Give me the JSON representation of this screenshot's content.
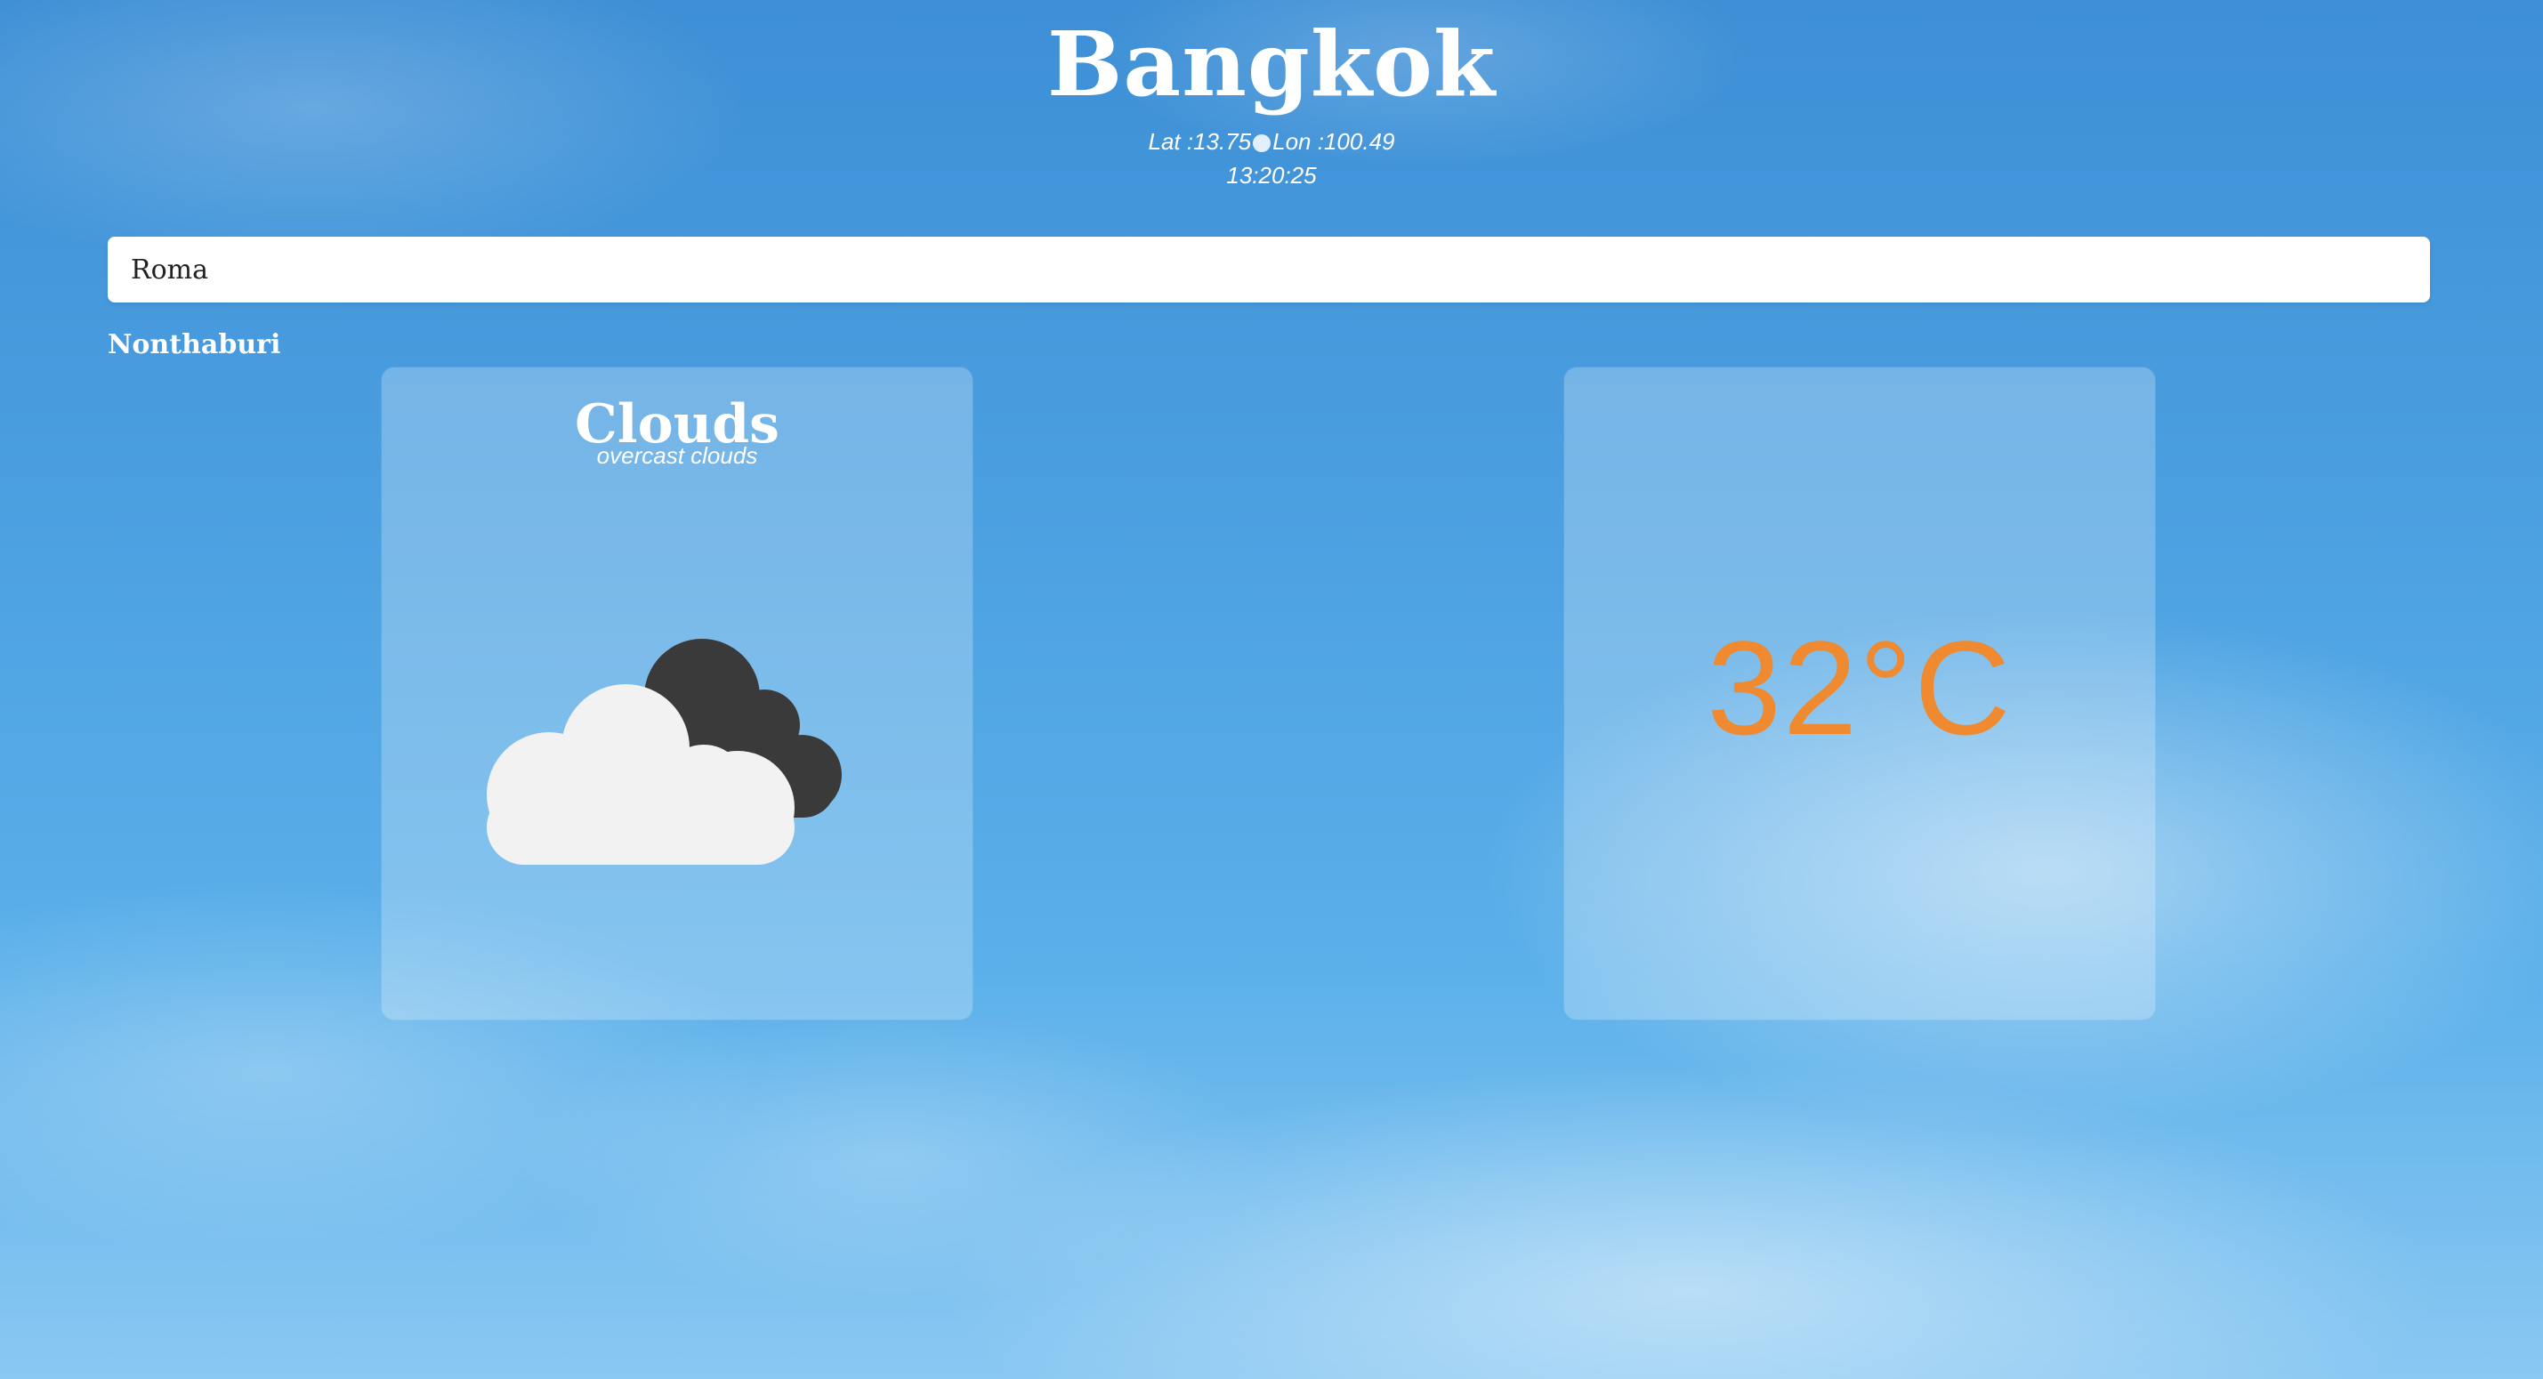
{
  "location": {
    "city": "Bangkok",
    "coords_lat": "Lat :13.75",
    "coords_lon": "Lon :100.49",
    "time": "13:20:25"
  },
  "search": {
    "value": "Roma",
    "placeholder": ""
  },
  "suggestions": [
    "Nonthaburi"
  ],
  "weather": {
    "condition": "Clouds",
    "description": "overcast clouds",
    "icon": "overcast-clouds-icon"
  },
  "temperature": {
    "value": "32°C",
    "color": "#f08a30"
  }
}
